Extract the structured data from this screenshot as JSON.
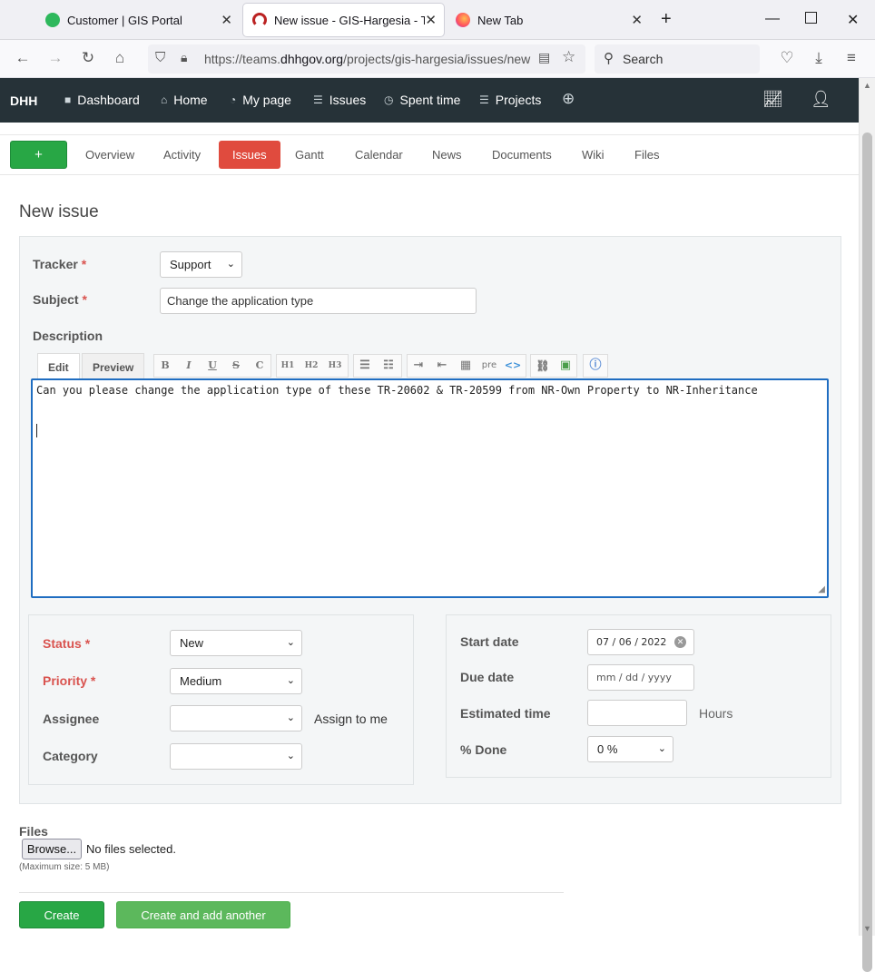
{
  "browser": {
    "tabs": [
      {
        "title": "Customer | GIS Portal",
        "icon": "portal-favicon"
      },
      {
        "title": "New issue - GIS-Hargesia - Team",
        "icon": "redmine-favicon"
      },
      {
        "title": "New Tab",
        "icon": "firefox-favicon"
      }
    ],
    "url_prefix": "https://teams.",
    "url_domain": "dhhgov.org",
    "url_path": "/projects/gis-hargesia/issues/new",
    "search_placeholder": "Search"
  },
  "app": {
    "brand": "DHH",
    "nav": [
      {
        "label": "Dashboard",
        "icon": "square-icon"
      },
      {
        "label": "Home",
        "icon": "home-icon"
      },
      {
        "label": "My page",
        "icon": "gauge-icon"
      },
      {
        "label": "Issues",
        "icon": "list-icon"
      },
      {
        "label": "Spent time",
        "icon": "clock-icon"
      },
      {
        "label": "Projects",
        "icon": "list-icon"
      }
    ]
  },
  "project_tabs": {
    "new_label": "+",
    "items": [
      "Overview",
      "Activity",
      "Issues",
      "Gantt",
      "Calendar",
      "News",
      "Documents",
      "Wiki",
      "Files"
    ],
    "active": "Issues"
  },
  "page": {
    "title": "New issue"
  },
  "form": {
    "tracker_label": "Tracker",
    "tracker_value": "Support",
    "subject_label": "Subject",
    "subject_value": "Change the application type",
    "description_label": "Description",
    "edit_tab": "Edit",
    "preview_tab": "Preview",
    "description_text": "Can you please change the application type of these TR-20602 & TR-20599 from NR-Own Property to NR-Inheritance",
    "toolbar": [
      "B",
      "I",
      "U",
      "S",
      "C",
      "H1",
      "H2",
      "H3",
      "ul",
      "ol",
      "indent",
      "outdent",
      "table",
      "pre",
      "code",
      "link",
      "image",
      "help"
    ],
    "status_label": "Status",
    "status_value": "New",
    "priority_label": "Priority",
    "priority_value": "Medium",
    "assignee_label": "Assignee",
    "assignee_value": "",
    "assign_to_me": "Assign to me",
    "category_label": "Category",
    "category_value": "",
    "start_date_label": "Start date",
    "start_date_value": "07 / 06 / 2022",
    "due_date_label": "Due date",
    "due_date_placeholder": "mm / dd / yyyy",
    "estimated_time_label": "Estimated time",
    "estimated_time_value": "",
    "hours_label": "Hours",
    "done_label": "% Done",
    "done_value": "0 %",
    "required_mark": "*"
  },
  "files": {
    "label": "Files",
    "browse": "Browse...",
    "no_files": "No files selected.",
    "max_size": "(Maximum size: 5 MB)"
  },
  "actions": {
    "create": "Create",
    "create_another": "Create and add another"
  },
  "colors": {
    "header_bg": "#263238",
    "accent_green": "#28a745",
    "active_tab_red": "#e04b3e",
    "required_red": "#d9534f",
    "editor_border": "#1f6dc1"
  }
}
